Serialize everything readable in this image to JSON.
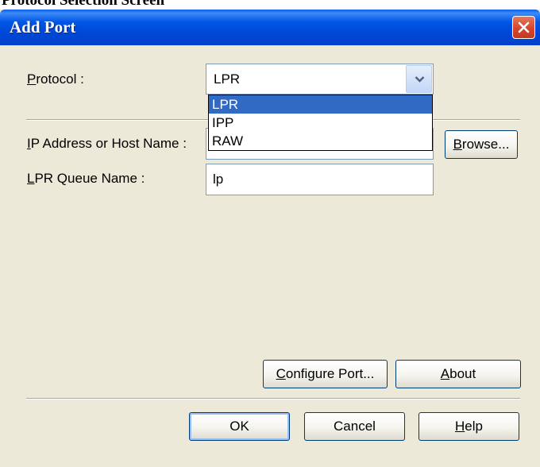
{
  "page_caption": "Protocol Selection Screen",
  "dialog": {
    "title": "Add Port",
    "protocol": {
      "label_mnemonic": "P",
      "label_rest": "rotocol :",
      "selected_value": "LPR",
      "options": [
        "LPR",
        "IPP",
        "RAW"
      ]
    },
    "ip_address": {
      "label_mnemonic": "I",
      "label_rest": "P Address or Host Name :",
      "value": ""
    },
    "browse_button": {
      "mnemonic": "B",
      "rest": "rowse..."
    },
    "lpr_queue": {
      "label_mnemonic": "L",
      "label_rest": "PR Queue Name :",
      "value": "lp"
    },
    "configure_port_button": {
      "mnemonic": "C",
      "rest": "onfigure Port..."
    },
    "about_button": {
      "mnemonic": "A",
      "rest": "bout"
    },
    "ok_button": {
      "label": "OK"
    },
    "cancel_button": {
      "label": "Cancel"
    },
    "help_button": {
      "mnemonic": "H",
      "rest": "elp"
    }
  },
  "colors": {
    "titlebar": "#0055e5",
    "dialog_background": "#ece9d8",
    "selection_highlight": "#316ac5",
    "close_button": "#d6452b"
  },
  "icons": {
    "close": "close-x-icon",
    "combo_arrow": "chevron-down-icon"
  }
}
